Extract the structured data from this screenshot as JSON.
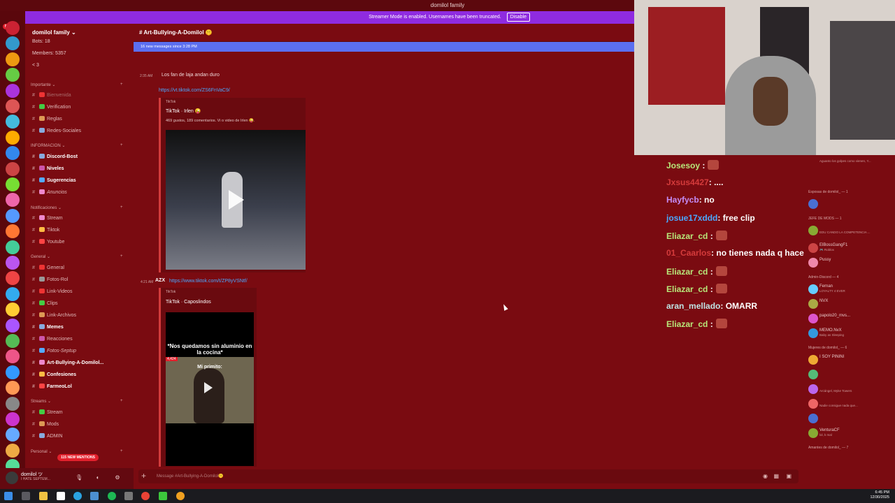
{
  "window": {
    "title": "domilol family"
  },
  "banner": {
    "text": "Streamer Mode is enabled. Usernames have been truncated.",
    "disable_label": "Disable"
  },
  "server": {
    "name": "domilol family ⌄",
    "stats": [
      "Bots: 18",
      "Members: 5357",
      "< 3"
    ]
  },
  "categories": [
    {
      "label": "Importante ⌄",
      "channels": [
        {
          "label": "Bienvenida",
          "style": "muted"
        },
        {
          "label": "Verification",
          "style": "normal"
        },
        {
          "label": "Reglas",
          "style": "normal"
        },
        {
          "label": "Redes-Sociales",
          "style": "normal"
        }
      ]
    },
    {
      "label": "INFORMACION ⌄",
      "channels": [
        {
          "label": "Discord-Bost",
          "style": "bold"
        },
        {
          "label": "Niveles",
          "style": "bold"
        },
        {
          "label": "Sugerencias",
          "style": "bold"
        },
        {
          "label": "Anuncios",
          "style": "italic"
        }
      ]
    },
    {
      "label": "Notificaciones ⌄",
      "channels": [
        {
          "label": "Stream",
          "style": "normal"
        },
        {
          "label": "Tiktok",
          "style": "normal"
        },
        {
          "label": "Youtube",
          "style": "normal"
        }
      ]
    },
    {
      "label": "General ⌄",
      "channels": [
        {
          "label": "General",
          "style": "normal"
        },
        {
          "label": "Fotos-Rol",
          "style": "normal"
        },
        {
          "label": "Link-Videos",
          "style": "normal"
        },
        {
          "label": "Clips",
          "style": "normal"
        },
        {
          "label": "Link-Archivos",
          "style": "normal"
        },
        {
          "label": "Memes",
          "style": "bold"
        },
        {
          "label": "Reacciones",
          "style": "normal"
        },
        {
          "label": "Fotos-Septup",
          "style": "italic"
        },
        {
          "label": "Art-Bullying-A-Domilol...",
          "style": "selected"
        },
        {
          "label": "Confesiones",
          "style": "bold"
        },
        {
          "label": "FarmeoLol",
          "style": "bold"
        }
      ]
    },
    {
      "label": "Streams ⌄",
      "channels": [
        {
          "label": "Stream",
          "style": "normal"
        },
        {
          "label": "Mods",
          "style": "normal"
        },
        {
          "label": "ADMIN",
          "style": "normal"
        }
      ]
    },
    {
      "label": "Personal ⌄",
      "channels": []
    }
  ],
  "mentions_badge": "115 NEW MENTIONS",
  "user": {
    "name": "domilol ツ",
    "status": "I HATE SEPTEM..."
  },
  "channel": {
    "title": "Art-Bullying-A-Domilol 🤫"
  },
  "new_messages": "16 new messages since 3:28 PM",
  "messages": [
    {
      "time": "2:35 AM",
      "text": "Los fan de laja andan duro"
    },
    {
      "link": "https://vt.tiktok.com/ZS6FnVaC9/",
      "provider": "TikTok",
      "title": "TikTok · Irlen 😜",
      "desc": "469 gustos, 189 comentarios. Vi o video de Irlen 😜."
    },
    {
      "time": "4:21 AM",
      "author": "AZX",
      "link": "https://www.tiktok.com/t/ZP8yVSNtf/",
      "provider": "TikTok",
      "title": "TikTok · Caposlindos",
      "video_text": "*Nos quedamos sin aluminio en la cocina*",
      "video_sub": "Mi primito:",
      "views": "4,424"
    }
  ],
  "composer": {
    "placeholder": "Message #Art-Bullying-A-Domilol🤫"
  },
  "stream_chat": [
    {
      "user": "Josesoy",
      "msg": "",
      "color": "#b8e87a",
      "emote": true
    },
    {
      "user": "Jxsus4427",
      "msg": ": ....",
      "color": "#d43b3b",
      "emote": false
    },
    {
      "user": "Hayfycb",
      "msg": ": no",
      "color": "#c48cf5",
      "emote": false
    },
    {
      "user": "josue17xddd",
      "msg": ": free clip",
      "color": "#4aa8ff",
      "emote": false
    },
    {
      "user": "Eliazar_cd",
      "msg": "",
      "color": "#b8e87a",
      "emote": true
    },
    {
      "user": "01_Caarlos",
      "msg": ": no tienes nada q hacer ??",
      "color": "#d43b3b",
      "emote": false
    },
    {
      "user": "Eliazar_cd",
      "msg": "",
      "color": "#b8e87a",
      "emote": true
    },
    {
      "user": "Eliazar_cd",
      "msg": "",
      "color": "#b8e87a",
      "emote": true
    },
    {
      "user": "aran_mellado",
      "msg": ": OMARR",
      "color": "#bfe3e3",
      "emote": false
    },
    {
      "user": "Eliazar_cd",
      "msg": "",
      "color": "#b8e87a",
      "emote": true
    }
  ],
  "members": {
    "top_status": "Aguanto los golpes como vienen, Y...",
    "groups": [
      {
        "label": "Esposas de domilol_ — 1",
        "items": [
          {
            "name": "",
            "sub": ""
          }
        ]
      },
      {
        "label": "JEFE DE MODS — 1",
        "items": [
          {
            "name": "",
            "sub": "EDU CANDO LA COMPETENCIA ..."
          }
        ]
      },
      {
        "label": "",
        "items": [
          {
            "name": "ElBossGangF1",
            "sub": "🎮 Roblox"
          },
          {
            "name": "Pussy",
            "sub": ""
          }
        ]
      },
      {
        "label": "Admin-Discord — 4",
        "items": [
          {
            "name": "Fernan",
            "sub": "LOYALTY 4 EVER"
          },
          {
            "name": "NVX",
            "sub": ""
          },
          {
            "name": "papolo20_mvs...",
            "sub": ""
          },
          {
            "name": "MEMO.NvX",
            "sub": "Baby as Sleeping"
          }
        ]
      },
      {
        "label": "Mujeres de domilol_ — 6",
        "items": [
          {
            "name": "I SOY PININI",
            "sub": ""
          },
          {
            "name": "",
            "sub": ""
          },
          {
            "name": "",
            "sub": "Arcángel, Myke Towers"
          },
          {
            "name": "",
            "sub": "Nadie consigue nada que..."
          },
          {
            "name": "",
            "sub": ""
          },
          {
            "name": "VenturaCF",
            "sub": "lol, k mal"
          }
        ]
      },
      {
        "label": "Amantes de domilol_ — 7",
        "items": []
      }
    ]
  },
  "taskbar": {
    "time": "6:45 PM",
    "date": "12/30/2025"
  }
}
